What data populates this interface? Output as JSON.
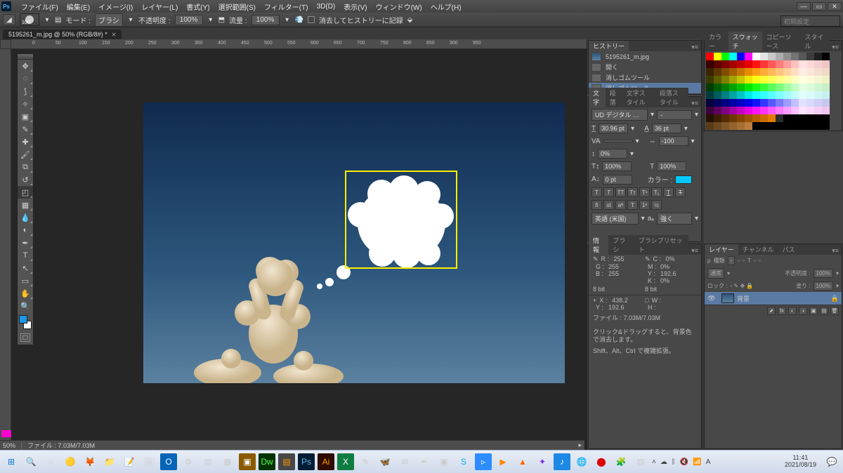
{
  "menubar": {
    "items": [
      "ファイル(F)",
      "編集(E)",
      "イメージ(I)",
      "レイヤー(L)",
      "書式(Y)",
      "選択範囲(S)",
      "フィルター(T)",
      "3D(D)",
      "表示(V)",
      "ウィンドウ(W)",
      "ヘルプ(H)"
    ]
  },
  "optionsbar": {
    "brush_size": "100",
    "mode_label": "モード :",
    "mode_value": "ブラシ",
    "opacity_label": "不透明度 :",
    "opacity_value": "100%",
    "flow_label": "流量 :",
    "flow_value": "100%",
    "erase_history": "消去してヒストリーに記録",
    "search_placeholder": "初期設定"
  },
  "document": {
    "tab_title": "5195261_m.jpg @ 50% (RGB/8#) *",
    "zoom": "50%",
    "status_file": "ファイル : 7.03M/7.03M"
  },
  "ruler_ticks": [
    "0",
    "50",
    "100",
    "150",
    "200",
    "250",
    "300",
    "350",
    "400",
    "450",
    "500",
    "550",
    "600",
    "650",
    "700",
    "750",
    "800",
    "850",
    "900",
    "950"
  ],
  "history": {
    "tab": "ヒストリー",
    "items": [
      {
        "icon": "file",
        "label": "5195261_m.jpg"
      },
      {
        "icon": "open",
        "label": "開く"
      },
      {
        "icon": "eraser",
        "label": "消しゴムツール"
      },
      {
        "icon": "eraser",
        "label": "消しゴムツール",
        "selected": true
      }
    ]
  },
  "character": {
    "tabs": [
      "文字",
      "段落",
      "文字スタイル",
      "段落スタイル"
    ],
    "font": "UD デジタル …",
    "style": "-",
    "size": "30.96 pt",
    "leading": "36 pt",
    "va_label": "VA",
    "tracking": "-100",
    "scale_v": "0%",
    "scale_h": "100%",
    "scale_h2": "100%",
    "baseline": "0 pt",
    "color_label": "カラー :",
    "lang_label": "英語 (米国)",
    "aa_label": "強く"
  },
  "panel_right": {
    "tabs": [
      "カラー",
      "スウォッチ",
      "コピーソース",
      "スタイル"
    ],
    "tabs2": [
      "レイヤー",
      "チャンネル",
      "パス"
    ]
  },
  "swatches_colors": [
    "#ff0000",
    "#ffff00",
    "#00ff00",
    "#00ffff",
    "#0000ff",
    "#ff00ff",
    "#ffffff",
    "#e4e4e4",
    "#c8c8c8",
    "#acacac",
    "#909090",
    "#747474",
    "#585858",
    "#3c3c3c",
    "#202020",
    "#000000",
    "#3b0000",
    "#5d0000",
    "#800000",
    "#a30000",
    "#c50000",
    "#e80000",
    "#ff1414",
    "#ff3636",
    "#ff5858",
    "#ff7b7b",
    "#ff9d9d",
    "#ffc0c0",
    "#ffe2e2",
    "#fbd9d9",
    "#f5cfcf",
    "#f0c6c6",
    "#3b2400",
    "#5d3800",
    "#804d00",
    "#a36100",
    "#c57600",
    "#e88a00",
    "#ff9e14",
    "#ffab36",
    "#ffb858",
    "#ffc57b",
    "#ffd29d",
    "#ffdfc0",
    "#ffece2",
    "#fbe6d9",
    "#f5e0cf",
    "#f0d9c6",
    "#3b3b00",
    "#5d5d00",
    "#808000",
    "#a3a300",
    "#c5c500",
    "#e8e800",
    "#ffff14",
    "#ffff36",
    "#ffff58",
    "#ffff7b",
    "#ffff9d",
    "#ffffc0",
    "#ffffe2",
    "#fbfbd9",
    "#f5f5cf",
    "#f0f0c6",
    "#003b00",
    "#005d00",
    "#008000",
    "#00a300",
    "#00c500",
    "#00e800",
    "#14ff14",
    "#36ff36",
    "#58ff58",
    "#7bff7b",
    "#9dff9d",
    "#c0ffc0",
    "#e2ffe2",
    "#d9fbd9",
    "#cff5cf",
    "#c6f0c6",
    "#003b3b",
    "#005d5d",
    "#008080",
    "#00a3a3",
    "#00c5c5",
    "#00e8e8",
    "#14ffff",
    "#36ffff",
    "#58ffff",
    "#7bffff",
    "#9dffff",
    "#c0ffff",
    "#e2ffff",
    "#d9fbfb",
    "#cff5f5",
    "#c6f0f0",
    "#00003b",
    "#00005d",
    "#000080",
    "#0000a3",
    "#0000c5",
    "#0000e8",
    "#1414ff",
    "#3636ff",
    "#5858ff",
    "#7b7bff",
    "#9d9dff",
    "#c0c0ff",
    "#e2e2ff",
    "#d9d9fb",
    "#cfcff5",
    "#c6c6f0",
    "#3b003b",
    "#5d005d",
    "#800080",
    "#a300a3",
    "#c500c5",
    "#e800e8",
    "#ff14ff",
    "#ff36ff",
    "#ff58ff",
    "#ff7bff",
    "#ff9dff",
    "#ffc0ff",
    "#ffe2ff",
    "#fbd9fb",
    "#f5cff5",
    "#f0c6f0",
    "#241200",
    "#3c1f00",
    "#542c00",
    "#6c3900",
    "#844600",
    "#9c5300",
    "#b46000",
    "#cc6d00",
    "#e47a00",
    "#2c2c2c",
    "#000000",
    "#000000",
    "#000000",
    "#000000",
    "#000000",
    "#000000",
    "#5a3b1a",
    "#6d4821",
    "#805528",
    "#93622f",
    "#a66f36",
    "#b97c3d",
    "#000000",
    "#000000",
    "#000000",
    "#000000",
    "#000000",
    "#000000",
    "#000000",
    "#000000",
    "#000000",
    "#000000"
  ],
  "info": {
    "tabs": [
      "情報",
      "ブラシ",
      "ブラシプリセット"
    ],
    "r_label": "R :",
    "g_label": "G :",
    "b_label": "B :",
    "r": "255",
    "g": "255",
    "b": "255",
    "c_label": "C :",
    "m_label": "M :",
    "y_label": "Y :",
    "k_label": "K :",
    "c": "0%",
    "m": "0%",
    "y": "192.6",
    "k": "0%",
    "bits": "8 bit",
    "bits2": "8 bit",
    "x_label": "X :",
    "x": "438.2",
    "w_label": "W :",
    "h_label": "H :",
    "w": "",
    "h": "",
    "file_label": "ファイル : 7.03M/7.03M",
    "note1": "クリック&ドラッグすると、背景色で消去します。",
    "note2": "Shift、Alt、Ctrl で複雑拡張。"
  },
  "layers": {
    "blend": "通常",
    "opacity_label": "不透明度 :",
    "opacity": "100%",
    "lock_label": "ロック :",
    "fill_label": "塗り :",
    "fill": "100%",
    "layer_name": "背景",
    "kind_label": "種類",
    "lock_icon": "🔒"
  },
  "taskbar": {
    "time": "11:41",
    "date": "2021/08/19",
    "ime": "A"
  }
}
